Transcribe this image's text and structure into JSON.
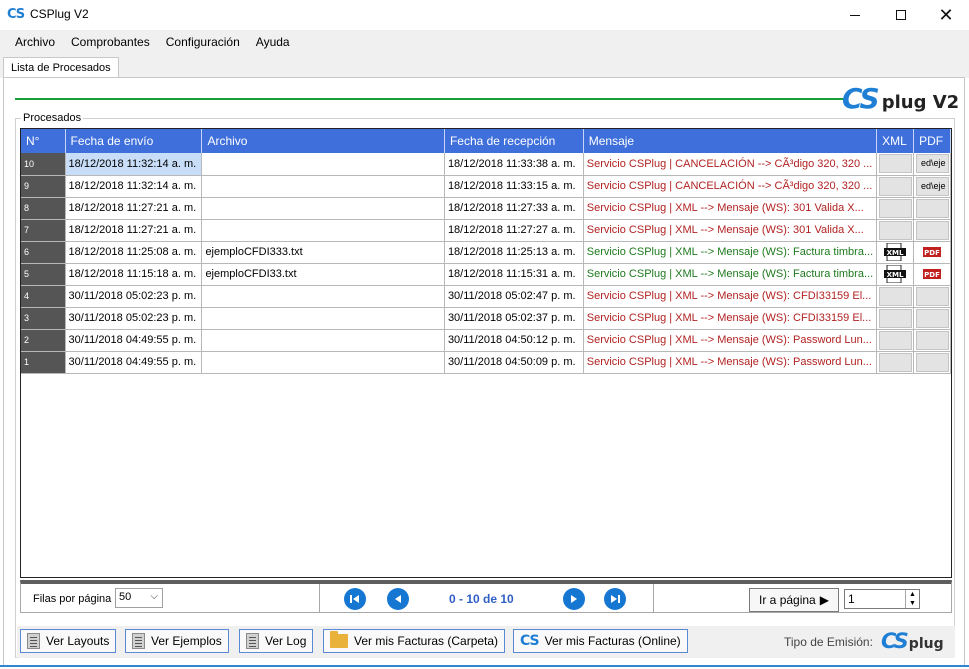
{
  "window": {
    "title": "CSPlug V2",
    "app_icon": "CS"
  },
  "menu": [
    "Archivo",
    "Comprobantes",
    "Configuración",
    "Ayuda"
  ],
  "tab": "Lista de Procesados",
  "brand": {
    "cs": "CS",
    "text": "plug V2"
  },
  "group_label": "Procesados",
  "columns": [
    "N°",
    "Fecha de envío",
    "Archivo",
    "Fecha de recepción",
    "Mensaje",
    "XML",
    "PDF"
  ],
  "rows": [
    {
      "num": "10",
      "envio": "18/12/2018 11:32:14 a. m.",
      "archivo": "",
      "recepcion": "18/12/2018 11:33:38 a. m.",
      "mensaje": "Servicio CSPlug |  CANCELACIÓN --> CÃ³digo 320, 320 ...",
      "status": "error",
      "xml": "",
      "pdf": "ed\\eje",
      "selected": true
    },
    {
      "num": "9",
      "envio": "18/12/2018 11:32:14 a. m.",
      "archivo": "",
      "recepcion": "18/12/2018 11:33:15 a. m.",
      "mensaje": "Servicio CSPlug |  CANCELACIÓN --> CÃ³digo 320, 320 ...",
      "status": "error",
      "xml": "",
      "pdf": "ed\\eje",
      "selected": false
    },
    {
      "num": "8",
      "envio": "18/12/2018 11:27:21 a. m.",
      "archivo": "",
      "recepcion": "18/12/2018 11:27:33 a. m.",
      "mensaje": "Servicio CSPlug |  XML --> Mensaje (WS): 301  Valida X...",
      "status": "error",
      "xml": "",
      "pdf": "",
      "selected": false
    },
    {
      "num": "7",
      "envio": "18/12/2018 11:27:21 a. m.",
      "archivo": "",
      "recepcion": "18/12/2018 11:27:27 a. m.",
      "mensaje": "Servicio CSPlug |  XML --> Mensaje (WS): 301  Valida X...",
      "status": "error",
      "xml": "",
      "pdf": "",
      "selected": false
    },
    {
      "num": "6",
      "envio": "18/12/2018 11:25:08 a. m.",
      "archivo": "ejemploCFDI333.txt",
      "recepcion": "18/12/2018 11:25:13 a. m.",
      "mensaje": "Servicio CSPlug |  XML --> Mensaje (WS): Factura timbra...",
      "status": "ok",
      "xml": "XML",
      "pdf": "PDF",
      "selected": false
    },
    {
      "num": "5",
      "envio": "18/12/2018 11:15:18 a. m.",
      "archivo": "ejemploCFDI33.txt",
      "recepcion": "18/12/2018 11:15:31 a. m.",
      "mensaje": "Servicio CSPlug |  XML --> Mensaje (WS): Factura timbra...",
      "status": "ok",
      "xml": "XML",
      "pdf": "PDF",
      "selected": false
    },
    {
      "num": "4",
      "envio": "30/11/2018 05:02:23 p. m.",
      "archivo": "",
      "recepcion": "30/11/2018 05:02:47 p. m.",
      "mensaje": "Servicio CSPlug |  XML --> Mensaje (WS): CFDI33159 El...",
      "status": "error",
      "xml": "",
      "pdf": "",
      "selected": false
    },
    {
      "num": "3",
      "envio": "30/11/2018 05:02:23 p. m.",
      "archivo": "",
      "recepcion": "30/11/2018 05:02:37 p. m.",
      "mensaje": "Servicio CSPlug |  XML --> Mensaje (WS): CFDI33159 El...",
      "status": "error",
      "xml": "",
      "pdf": "",
      "selected": false
    },
    {
      "num": "2",
      "envio": "30/11/2018 04:49:55 p. m.",
      "archivo": "",
      "recepcion": "30/11/2018 04:50:12 p. m.",
      "mensaje": "Servicio CSPlug |  XML --> Mensaje (WS): Password Lun...",
      "status": "error",
      "xml": "",
      "pdf": "",
      "selected": false
    },
    {
      "num": "1",
      "envio": "30/11/2018 04:49:55 p. m.",
      "archivo": "",
      "recepcion": "30/11/2018 04:50:09 p. m.",
      "mensaje": "Servicio CSPlug |  XML --> Mensaje (WS): Password Lun...",
      "status": "error",
      "xml": "",
      "pdf": "",
      "selected": false
    }
  ],
  "pager": {
    "rows_label": "Filas por página",
    "rows_value": "50",
    "page_info": "0 - 10 de 10",
    "goto_label": "Ir a página",
    "page_value": "1"
  },
  "buttons": {
    "layouts": "Ver Layouts",
    "ejemplos": "Ver Ejemplos",
    "log": "Ver Log",
    "carpeta": "Ver mis Facturas (Carpeta)",
    "online": "Ver mis Facturas (Online)"
  },
  "tipo_emision": {
    "label": "Tipo de Emisión:",
    "cs": "CS",
    "text": "plug"
  },
  "colors": {
    "accent": "#3f6fdb",
    "brand_blue": "#1f7fd4",
    "green_line": "#1a9e3c",
    "error_text": "#b22222",
    "ok_text": "#1e7a1e"
  }
}
